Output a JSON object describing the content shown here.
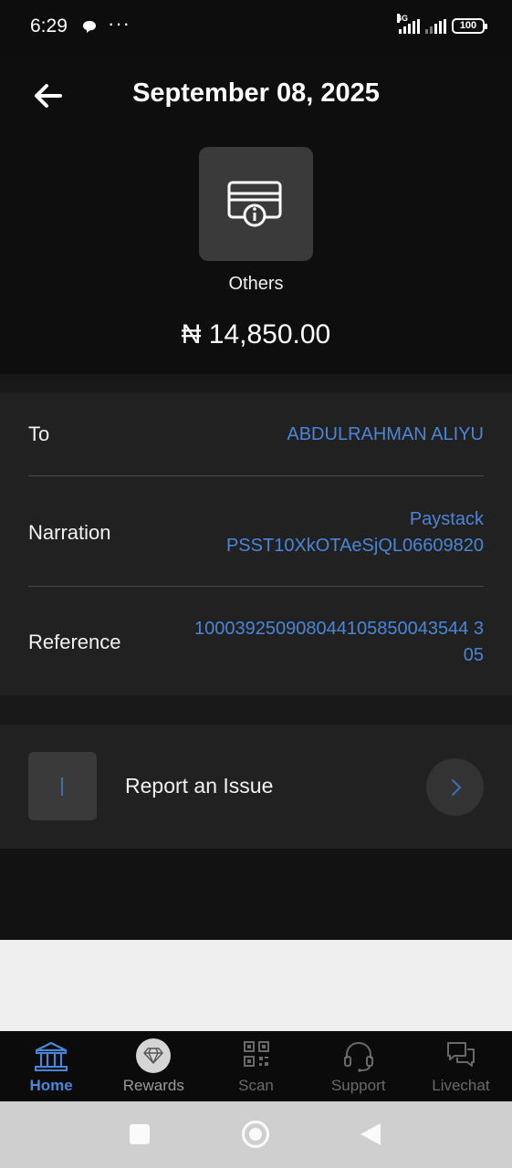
{
  "status_bar": {
    "time": "6:29",
    "extra": "•••",
    "network": "4G",
    "battery": "100"
  },
  "header": {
    "title": "September 08, 2025",
    "category": "Others",
    "amount": "₦ 14,850.00"
  },
  "details": {
    "to_label": "To",
    "to_value": "ABDULRAHMAN ALIYU",
    "narration_label": "Narration",
    "narration_line1": "Paystack",
    "narration_line2": "PSST10XkOTAeSjQL06609820",
    "reference_label": "Reference",
    "reference_line1": "100039250908044105850043544 3",
    "reference_line2": "05"
  },
  "report": {
    "label": "Report an Issue"
  },
  "bottom_nav": {
    "items": [
      {
        "label": "Home",
        "icon": "bank-icon",
        "active": true
      },
      {
        "label": "Rewards",
        "icon": "diamond-icon"
      },
      {
        "label": "Scan",
        "icon": "qr-code-icon"
      },
      {
        "label": "Support",
        "icon": "headset-icon"
      },
      {
        "label": "Livechat",
        "icon": "chat-bubbles-icon"
      }
    ]
  },
  "colors": {
    "accent": "#4a86d8",
    "background": "#121212",
    "card": "#212121"
  }
}
